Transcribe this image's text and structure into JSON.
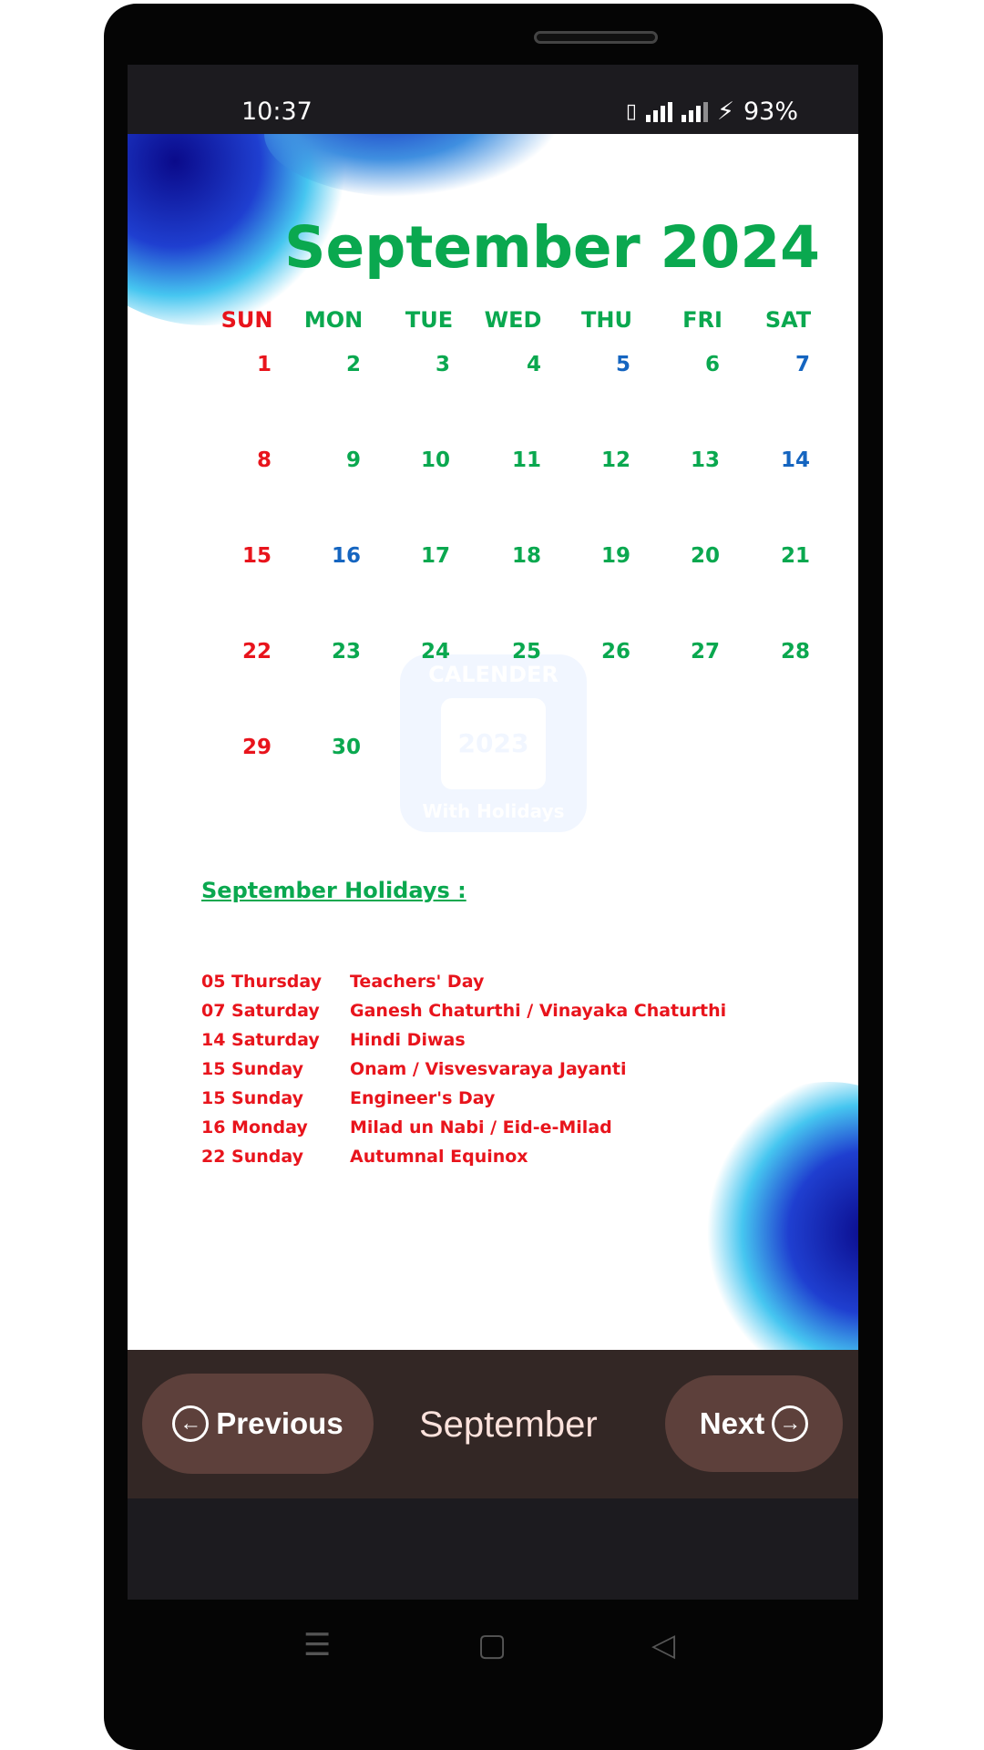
{
  "status": {
    "time": "10:37",
    "battery": "93%",
    "icons": [
      "vibrate-icon",
      "signal-icon",
      "signal-icon",
      "charging-icon"
    ]
  },
  "title": "September 2024",
  "weekdays": [
    "SUN",
    "MON",
    "TUE",
    "WED",
    "THU",
    "FRI",
    "SAT"
  ],
  "weeks": [
    [
      "1",
      "2",
      "3",
      "4",
      "5",
      "6",
      "7"
    ],
    [
      "8",
      "9",
      "10",
      "11",
      "12",
      "13",
      "14"
    ],
    [
      "15",
      "16",
      "17",
      "18",
      "19",
      "20",
      "21"
    ],
    [
      "22",
      "23",
      "24",
      "25",
      "26",
      "27",
      "28"
    ],
    [
      "29",
      "30",
      "",
      "",
      "",
      "",
      ""
    ]
  ],
  "colors": {
    "green": "#0aa84f",
    "red": "#e8141c",
    "blue": "#1565c0",
    "bar": "#332725",
    "button": "#5d403b"
  },
  "blue_dates": [
    "5",
    "7",
    "14",
    "16"
  ],
  "watermark": {
    "top": "CALENDER",
    "year": "2023",
    "bottom": "With Holidays"
  },
  "holidays": {
    "heading": "September Holidays :",
    "items": [
      {
        "date": "05 Thursday",
        "name": "Teachers' Day"
      },
      {
        "date": "07 Saturday",
        "name": "Ganesh Chaturthi / Vinayaka Chaturthi"
      },
      {
        "date": "14 Saturday",
        "name": "Hindi Diwas"
      },
      {
        "date": "15 Sunday",
        "name": "Onam / Visvesvaraya Jayanti"
      },
      {
        "date": "15 Sunday",
        "name": "Engineer's Day"
      },
      {
        "date": "16 Monday",
        "name": "Milad un Nabi / Eid-e-Milad"
      },
      {
        "date": "22 Sunday",
        "name": "Autumnal Equinox"
      }
    ]
  },
  "bottom": {
    "previous": "Previous",
    "month": "September",
    "next": "Next"
  }
}
